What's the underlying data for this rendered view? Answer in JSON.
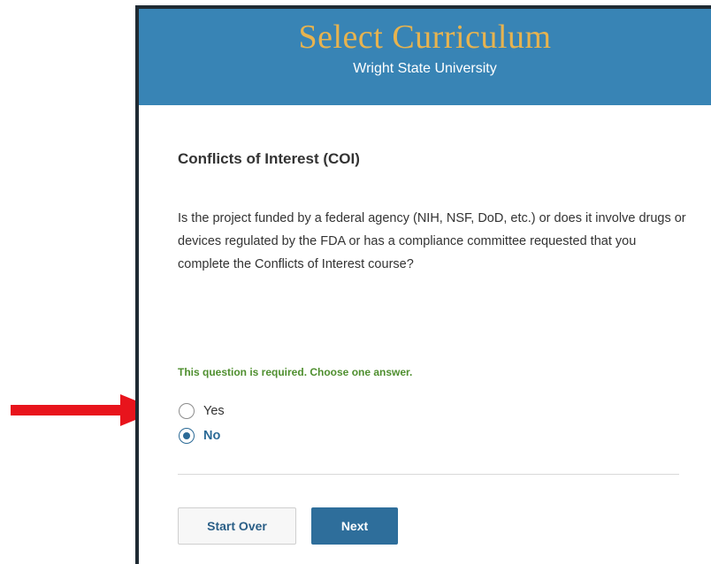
{
  "header": {
    "title": "Select Curriculum",
    "subtitle": "Wright State University"
  },
  "section": {
    "title": "Conflicts of Interest (COI)",
    "question": "Is the project funded by a federal agency (NIH, NSF, DoD, etc.) or does it involve drugs or devices regulated by the FDA or has a compliance committee requested that you complete the Conflicts of Interest course?",
    "required_note": "This question is required. Choose one answer."
  },
  "options": [
    {
      "label": "Yes",
      "selected": false
    },
    {
      "label": "No",
      "selected": true
    }
  ],
  "buttons": {
    "start_over": "Start Over",
    "next": "Next"
  },
  "colors": {
    "header_bg": "#3884b5",
    "title_color": "#e7b34f",
    "accent": "#2e6e9b",
    "required_green": "#4f8f2f",
    "arrow_red": "#e8141c"
  },
  "annotation": {
    "arrow_icon": "red-arrow-right"
  }
}
